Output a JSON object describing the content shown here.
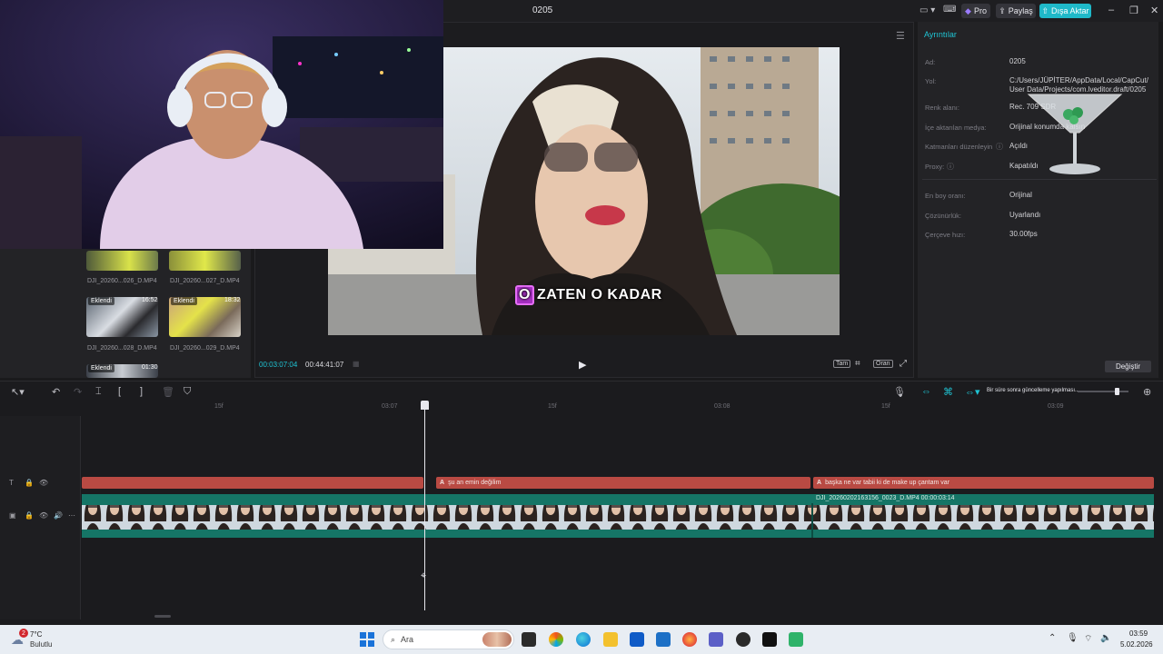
{
  "app": {
    "project_title": "0205",
    "pro_label": "Pro",
    "share_label": "Paylaş",
    "export_label": "Dışa Aktar"
  },
  "media": {
    "clips": [
      {
        "label": "DJI_20260...026_D.MP4"
      },
      {
        "label": "DJI_20260...027_D.MP4"
      },
      {
        "label": "DJI_20260...028_D.MP4",
        "tag": "Eklendi",
        "duration": "16:52"
      },
      {
        "label": "DJI_20260...029_D.MP4",
        "tag": "Eklendi",
        "duration": "18:32"
      },
      {
        "tag": "Eklendi",
        "duration": "01:30"
      }
    ]
  },
  "player": {
    "subtitle_highlight": "O",
    "subtitle_rest": "ZATEN O KADAR",
    "time_current": "00:03:07:04",
    "time_total": "00:44:41:07",
    "full_label": "Tam",
    "ratio_label": "Oran"
  },
  "details": {
    "title": "Ayrıntılar",
    "rows": [
      {
        "key": "Ad:",
        "value": "0205"
      },
      {
        "key": "Yol:",
        "value": "C:/Users/JÜPİTER/AppData/Local/CapCut/\nUser Data/Projects/com.lveditor.draft/0205"
      },
      {
        "key": "Renk alanı:",
        "value": "Rec. 709 SDR"
      },
      {
        "key": "İçe aktarılan medya:",
        "value": "Orijinal konumda kalsın"
      },
      {
        "key": "Katmanları düzenleyin",
        "value": "Açıldı"
      },
      {
        "key": "Proxy:",
        "value": "Kapatıldı"
      },
      {
        "key": "En boy oranı:",
        "value": "Orijinal"
      },
      {
        "key": "Çözünürlük:",
        "value": "Uyarlandı"
      },
      {
        "key": "Çerçeve hızı:",
        "value": "30.00fps"
      }
    ],
    "change_label": "Değiştir"
  },
  "timeline": {
    "ruler": [
      "15f",
      "03:07",
      "15f",
      "03:08",
      "15f",
      "03:09"
    ],
    "text_clips": [
      "şu an emin değilim",
      "başka ne var tabii ki de make up çantam var"
    ],
    "text_clip_prefix": "A",
    "video_clip_label": "DJI_20260202163156_0023_D.MP4   00:00:03:14",
    "hint_text": "Bir süre sonra güncelleme yapılması..."
  },
  "taskbar": {
    "weather_badge": "2",
    "weather_temp": "7°C",
    "weather_desc": "Bulutlu",
    "search_placeholder": "Ara",
    "time": "03:59",
    "date": "5.02.2026"
  },
  "colors": {
    "accent": "#1fc4d4",
    "text_clip": "#b94a43",
    "video_track": "#157566",
    "export": "#1fb9c9"
  }
}
